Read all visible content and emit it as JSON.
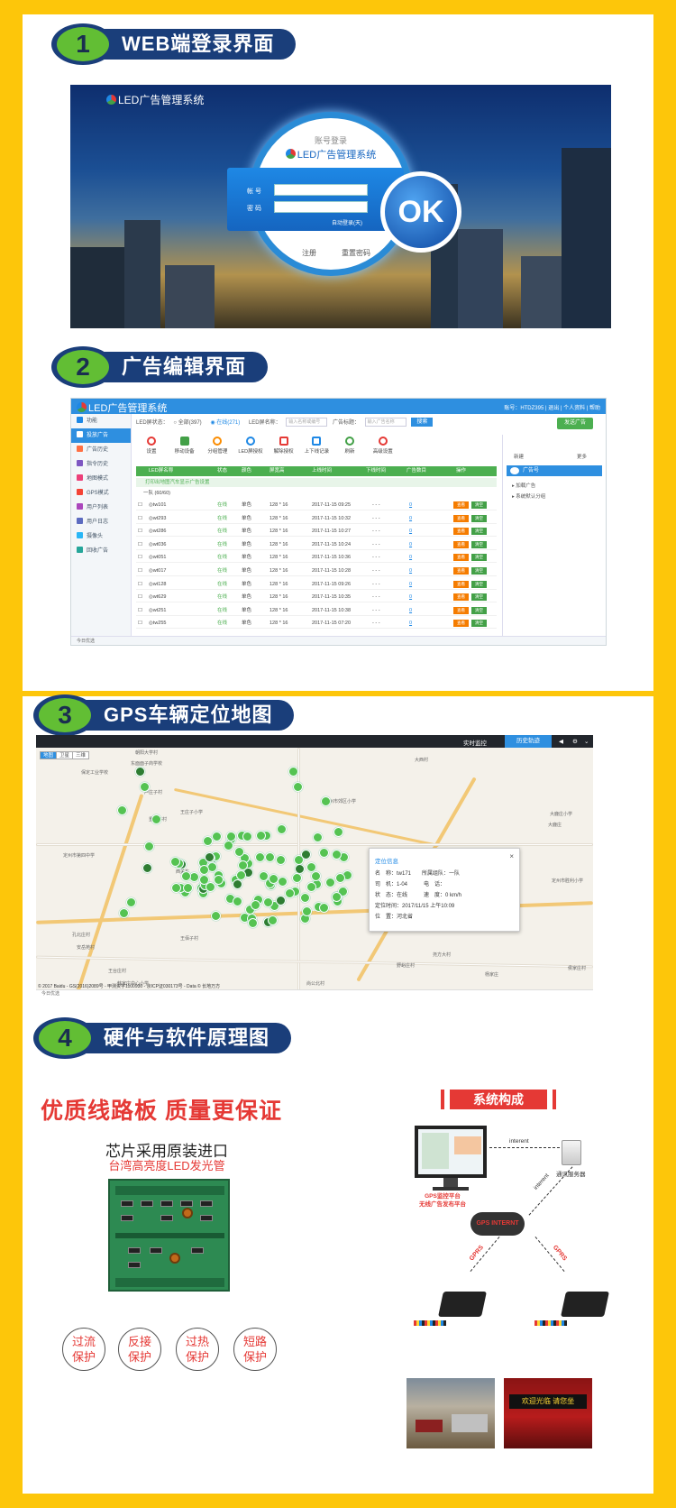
{
  "section1": {
    "num": "1",
    "title": "WEB端登录界面"
  },
  "login": {
    "app_title": "LED广告管理系统",
    "card_title": "账号登录",
    "card_app": "LED广告管理系统",
    "account_label": "帐 号",
    "password_label": "密 码",
    "remember": "自动登录(天)",
    "register": "注册",
    "reset": "重置密码",
    "ok": "OK"
  },
  "section2": {
    "num": "2",
    "title": "广告编辑界面"
  },
  "editor": {
    "app_title": "LED广告管理系统",
    "user_bar": "账号：HTDZ395 | 退出 | 个人资料 | 帮助",
    "sidebar": [
      "功能",
      "投放广告",
      "广告历史",
      "指令历史",
      "地图模式",
      "GPS模式",
      "用户列表",
      "用户日志",
      "摄像头",
      "回收广告"
    ],
    "filter_status_label": "LED屏状态：",
    "filter_all": "全部(397)",
    "filter_online": "在线(271)",
    "filter_name_label": "LED屏名称：",
    "filter_name_ph": "输入名称或编号",
    "filter_ad_label": "广告标题：",
    "filter_ad_ph": "输入广告名称",
    "search_btn": "搜索",
    "publish_btn": "发送广告",
    "tools": [
      "设置",
      "移动设备",
      "分组管理",
      "LED屏授权",
      "解除授权",
      "上下线记录",
      "刷新",
      "高级设置"
    ],
    "columns": [
      "LED屏名称",
      "状态",
      "颜色",
      "屏宽高",
      "上线时间",
      "下线时间",
      "广告数目",
      "操作"
    ],
    "group1": "打印出地图汽车显示广告设置",
    "group2": "一队 (60/60)",
    "rows": [
      {
        "name": "tw101",
        "status": "在线",
        "color": "单色",
        "size": "128 * 16",
        "time": "2017-11-15 09:25",
        "count": "0"
      },
      {
        "name": "wt293",
        "status": "在线",
        "color": "单色",
        "size": "128 * 16",
        "time": "2017-11-15 10:32",
        "count": "0"
      },
      {
        "name": "wt286",
        "status": "在线",
        "color": "单色",
        "size": "128 * 16",
        "time": "2017-11-15 10:27",
        "count": "0"
      },
      {
        "name": "wt036",
        "status": "在线",
        "color": "单色",
        "size": "128 * 16",
        "time": "2017-11-15 10:24",
        "count": "0"
      },
      {
        "name": "wt051",
        "status": "在线",
        "color": "单色",
        "size": "128 * 16",
        "time": "2017-11-15 10:36",
        "count": "0"
      },
      {
        "name": "wt017",
        "status": "在线",
        "color": "单色",
        "size": "128 * 16",
        "time": "2017-11-15 10:28",
        "count": "0"
      },
      {
        "name": "wt128",
        "status": "在线",
        "color": "单色",
        "size": "128 * 16",
        "time": "2017-11-15 09:26",
        "count": "0"
      },
      {
        "name": "wt629",
        "status": "在线",
        "color": "单色",
        "size": "128 * 16",
        "time": "2017-11-15 10:35",
        "count": "0"
      },
      {
        "name": "wt251",
        "status": "在线",
        "color": "单色",
        "size": "128 * 16",
        "time": "2017-11-15 10:38",
        "count": "0"
      },
      {
        "name": "tw255",
        "status": "在线",
        "color": "单色",
        "size": "128 * 16",
        "time": "2017-11-15 07:20",
        "count": "0"
      }
    ],
    "off_placeholder": "- - -",
    "btn_edit": "查看",
    "btn_view": "清空",
    "right_tools": [
      "新建",
      "更多"
    ],
    "right_selected": "广告号",
    "right_tree": [
      "加载广告",
      "系统默认分组"
    ],
    "bottom": "今日优选"
  },
  "section3": {
    "num": "3",
    "title": "GPS车辆定位地图"
  },
  "map": {
    "realtime": "实时监控",
    "history": "历史轨迹",
    "types": [
      "地图",
      "卫星",
      "三维"
    ],
    "villages": [
      "朝阳大学村",
      "东面面子商学校",
      "保定工业学校",
      "大西村",
      "芦庄子村",
      "重庄子村",
      "王庄子小学",
      "定州市郊区小学",
      "定州市第四中学",
      "西关东",
      "孔北庄村",
      "安岳苑村",
      "王台庄村",
      "韩家庄中心小学",
      "尧方大村",
      "野峪庄村",
      "王佰子村",
      "尚公北村",
      "东坦兴村",
      "大鹿庄小学",
      "大鹿庄",
      "定州市胜利小学",
      "杨家庄",
      "侯家庄村"
    ],
    "popup_title": "定位信息",
    "popup_rows": [
      "名　称：tw171　　所属组队：一队",
      "司　机：1-04　　　电　话：",
      "状　态：在线　　　速　度：0 km/h",
      "定位时间：2017/11/15 上午10:09",
      "位　置：河北省"
    ],
    "copyright": "© 2017 Baidu - GS(2016)2089号 - 甲测资字1100930 - 京ICP证030173号 - Data © 长地万方",
    "bottom": "今日优选"
  },
  "section4": {
    "num": "4",
    "title": "硬件与软件原理图"
  },
  "hardware": {
    "quality": "优质线路板 质量更保证",
    "chip_line1": "芯片采用原装进口",
    "chip_line2": "台湾高亮度LED发光管",
    "protections": [
      [
        "过流",
        "保护"
      ],
      [
        "反接",
        "保护"
      ],
      [
        "过热",
        "保护"
      ],
      [
        "短路",
        "保护"
      ]
    ],
    "system_title": "系统构成",
    "interent1": "interent",
    "interent2": "interent",
    "gps_platform": "GPS监控平台",
    "ad_platform": "无线广告发布平台",
    "server": "通讯服务器",
    "cloud": "GPS INTERNT",
    "gprs": "GPRS",
    "led_text": "欢迎光临  请您坐"
  },
  "colors": {
    "frame": "#FDC60A",
    "badge_blue": "#1A3E7A",
    "badge_green": "#62BE34",
    "accent_red": "#E53935",
    "ui_blue": "#2E8FE0"
  }
}
